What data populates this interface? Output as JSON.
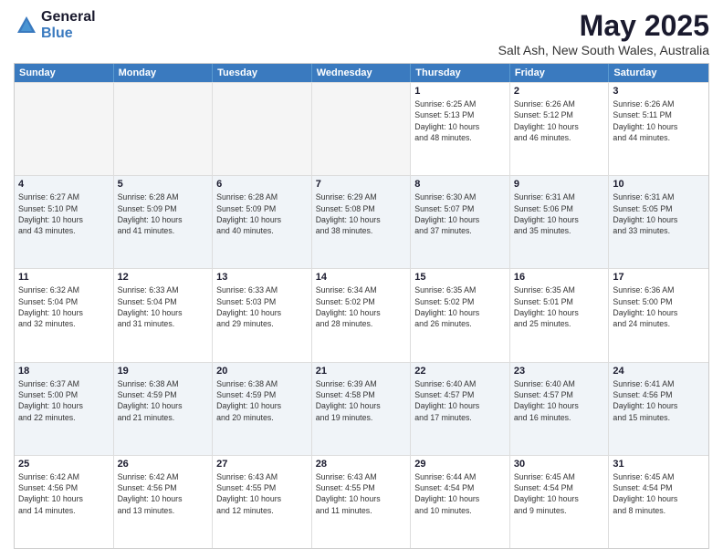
{
  "logo": {
    "general": "General",
    "blue": "Blue"
  },
  "title": "May 2025",
  "location": "Salt Ash, New South Wales, Australia",
  "header_days": [
    "Sunday",
    "Monday",
    "Tuesday",
    "Wednesday",
    "Thursday",
    "Friday",
    "Saturday"
  ],
  "rows": [
    [
      {
        "day": "",
        "lines": [],
        "empty": true
      },
      {
        "day": "",
        "lines": [],
        "empty": true
      },
      {
        "day": "",
        "lines": [],
        "empty": true
      },
      {
        "day": "",
        "lines": [],
        "empty": true
      },
      {
        "day": "1",
        "lines": [
          "Sunrise: 6:25 AM",
          "Sunset: 5:13 PM",
          "Daylight: 10 hours",
          "and 48 minutes."
        ]
      },
      {
        "day": "2",
        "lines": [
          "Sunrise: 6:26 AM",
          "Sunset: 5:12 PM",
          "Daylight: 10 hours",
          "and 46 minutes."
        ]
      },
      {
        "day": "3",
        "lines": [
          "Sunrise: 6:26 AM",
          "Sunset: 5:11 PM",
          "Daylight: 10 hours",
          "and 44 minutes."
        ]
      }
    ],
    [
      {
        "day": "4",
        "lines": [
          "Sunrise: 6:27 AM",
          "Sunset: 5:10 PM",
          "Daylight: 10 hours",
          "and 43 minutes."
        ]
      },
      {
        "day": "5",
        "lines": [
          "Sunrise: 6:28 AM",
          "Sunset: 5:09 PM",
          "Daylight: 10 hours",
          "and 41 minutes."
        ]
      },
      {
        "day": "6",
        "lines": [
          "Sunrise: 6:28 AM",
          "Sunset: 5:09 PM",
          "Daylight: 10 hours",
          "and 40 minutes."
        ]
      },
      {
        "day": "7",
        "lines": [
          "Sunrise: 6:29 AM",
          "Sunset: 5:08 PM",
          "Daylight: 10 hours",
          "and 38 minutes."
        ]
      },
      {
        "day": "8",
        "lines": [
          "Sunrise: 6:30 AM",
          "Sunset: 5:07 PM",
          "Daylight: 10 hours",
          "and 37 minutes."
        ]
      },
      {
        "day": "9",
        "lines": [
          "Sunrise: 6:31 AM",
          "Sunset: 5:06 PM",
          "Daylight: 10 hours",
          "and 35 minutes."
        ]
      },
      {
        "day": "10",
        "lines": [
          "Sunrise: 6:31 AM",
          "Sunset: 5:05 PM",
          "Daylight: 10 hours",
          "and 33 minutes."
        ]
      }
    ],
    [
      {
        "day": "11",
        "lines": [
          "Sunrise: 6:32 AM",
          "Sunset: 5:04 PM",
          "Daylight: 10 hours",
          "and 32 minutes."
        ]
      },
      {
        "day": "12",
        "lines": [
          "Sunrise: 6:33 AM",
          "Sunset: 5:04 PM",
          "Daylight: 10 hours",
          "and 31 minutes."
        ]
      },
      {
        "day": "13",
        "lines": [
          "Sunrise: 6:33 AM",
          "Sunset: 5:03 PM",
          "Daylight: 10 hours",
          "and 29 minutes."
        ]
      },
      {
        "day": "14",
        "lines": [
          "Sunrise: 6:34 AM",
          "Sunset: 5:02 PM",
          "Daylight: 10 hours",
          "and 28 minutes."
        ]
      },
      {
        "day": "15",
        "lines": [
          "Sunrise: 6:35 AM",
          "Sunset: 5:02 PM",
          "Daylight: 10 hours",
          "and 26 minutes."
        ]
      },
      {
        "day": "16",
        "lines": [
          "Sunrise: 6:35 AM",
          "Sunset: 5:01 PM",
          "Daylight: 10 hours",
          "and 25 minutes."
        ]
      },
      {
        "day": "17",
        "lines": [
          "Sunrise: 6:36 AM",
          "Sunset: 5:00 PM",
          "Daylight: 10 hours",
          "and 24 minutes."
        ]
      }
    ],
    [
      {
        "day": "18",
        "lines": [
          "Sunrise: 6:37 AM",
          "Sunset: 5:00 PM",
          "Daylight: 10 hours",
          "and 22 minutes."
        ]
      },
      {
        "day": "19",
        "lines": [
          "Sunrise: 6:38 AM",
          "Sunset: 4:59 PM",
          "Daylight: 10 hours",
          "and 21 minutes."
        ]
      },
      {
        "day": "20",
        "lines": [
          "Sunrise: 6:38 AM",
          "Sunset: 4:59 PM",
          "Daylight: 10 hours",
          "and 20 minutes."
        ]
      },
      {
        "day": "21",
        "lines": [
          "Sunrise: 6:39 AM",
          "Sunset: 4:58 PM",
          "Daylight: 10 hours",
          "and 19 minutes."
        ]
      },
      {
        "day": "22",
        "lines": [
          "Sunrise: 6:40 AM",
          "Sunset: 4:57 PM",
          "Daylight: 10 hours",
          "and 17 minutes."
        ]
      },
      {
        "day": "23",
        "lines": [
          "Sunrise: 6:40 AM",
          "Sunset: 4:57 PM",
          "Daylight: 10 hours",
          "and 16 minutes."
        ]
      },
      {
        "day": "24",
        "lines": [
          "Sunrise: 6:41 AM",
          "Sunset: 4:56 PM",
          "Daylight: 10 hours",
          "and 15 minutes."
        ]
      }
    ],
    [
      {
        "day": "25",
        "lines": [
          "Sunrise: 6:42 AM",
          "Sunset: 4:56 PM",
          "Daylight: 10 hours",
          "and 14 minutes."
        ]
      },
      {
        "day": "26",
        "lines": [
          "Sunrise: 6:42 AM",
          "Sunset: 4:56 PM",
          "Daylight: 10 hours",
          "and 13 minutes."
        ]
      },
      {
        "day": "27",
        "lines": [
          "Sunrise: 6:43 AM",
          "Sunset: 4:55 PM",
          "Daylight: 10 hours",
          "and 12 minutes."
        ]
      },
      {
        "day": "28",
        "lines": [
          "Sunrise: 6:43 AM",
          "Sunset: 4:55 PM",
          "Daylight: 10 hours",
          "and 11 minutes."
        ]
      },
      {
        "day": "29",
        "lines": [
          "Sunrise: 6:44 AM",
          "Sunset: 4:54 PM",
          "Daylight: 10 hours",
          "and 10 minutes."
        ]
      },
      {
        "day": "30",
        "lines": [
          "Sunrise: 6:45 AM",
          "Sunset: 4:54 PM",
          "Daylight: 10 hours",
          "and 9 minutes."
        ]
      },
      {
        "day": "31",
        "lines": [
          "Sunrise: 6:45 AM",
          "Sunset: 4:54 PM",
          "Daylight: 10 hours",
          "and 8 minutes."
        ]
      }
    ]
  ]
}
